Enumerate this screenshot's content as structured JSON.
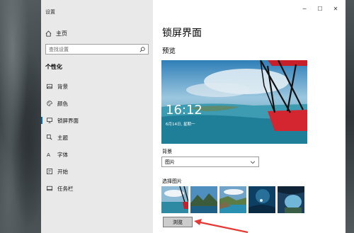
{
  "window": {
    "title": "设置",
    "controls": {
      "minimize": "─",
      "maximize": "☐",
      "close": "✕"
    }
  },
  "sidebar": {
    "home_label": "主页",
    "search": {
      "placeholder": "查找设置"
    },
    "section_title": "个性化",
    "items": [
      {
        "label": "背景",
        "icon": "picture-icon"
      },
      {
        "label": "颜色",
        "icon": "palette-icon"
      },
      {
        "label": "锁屏界面",
        "icon": "monitor-icon",
        "active": true
      },
      {
        "label": "主题",
        "icon": "brush-icon"
      },
      {
        "label": "字体",
        "icon": "font-icon"
      },
      {
        "label": "开始",
        "icon": "start-icon"
      },
      {
        "label": "任务栏",
        "icon": "taskbar-icon"
      }
    ]
  },
  "main": {
    "page_title": "锁屏界面",
    "preview_label": "预览",
    "preview": {
      "time": "16:12",
      "date": "6月14日, 星期一"
    },
    "background_label": "背景",
    "background_select": {
      "value": "图片"
    },
    "choose_picture_label": "选择图片",
    "thumbnails": [
      "plane-cockpit",
      "mountain-lake",
      "coastal-cliffs",
      "underwater-diver",
      "ice-cave"
    ],
    "browse_button": "浏览"
  },
  "colors": {
    "sidebar_bg": "#e9e9e9",
    "accent": "#0067c0",
    "annotation_arrow": "#e53935"
  }
}
